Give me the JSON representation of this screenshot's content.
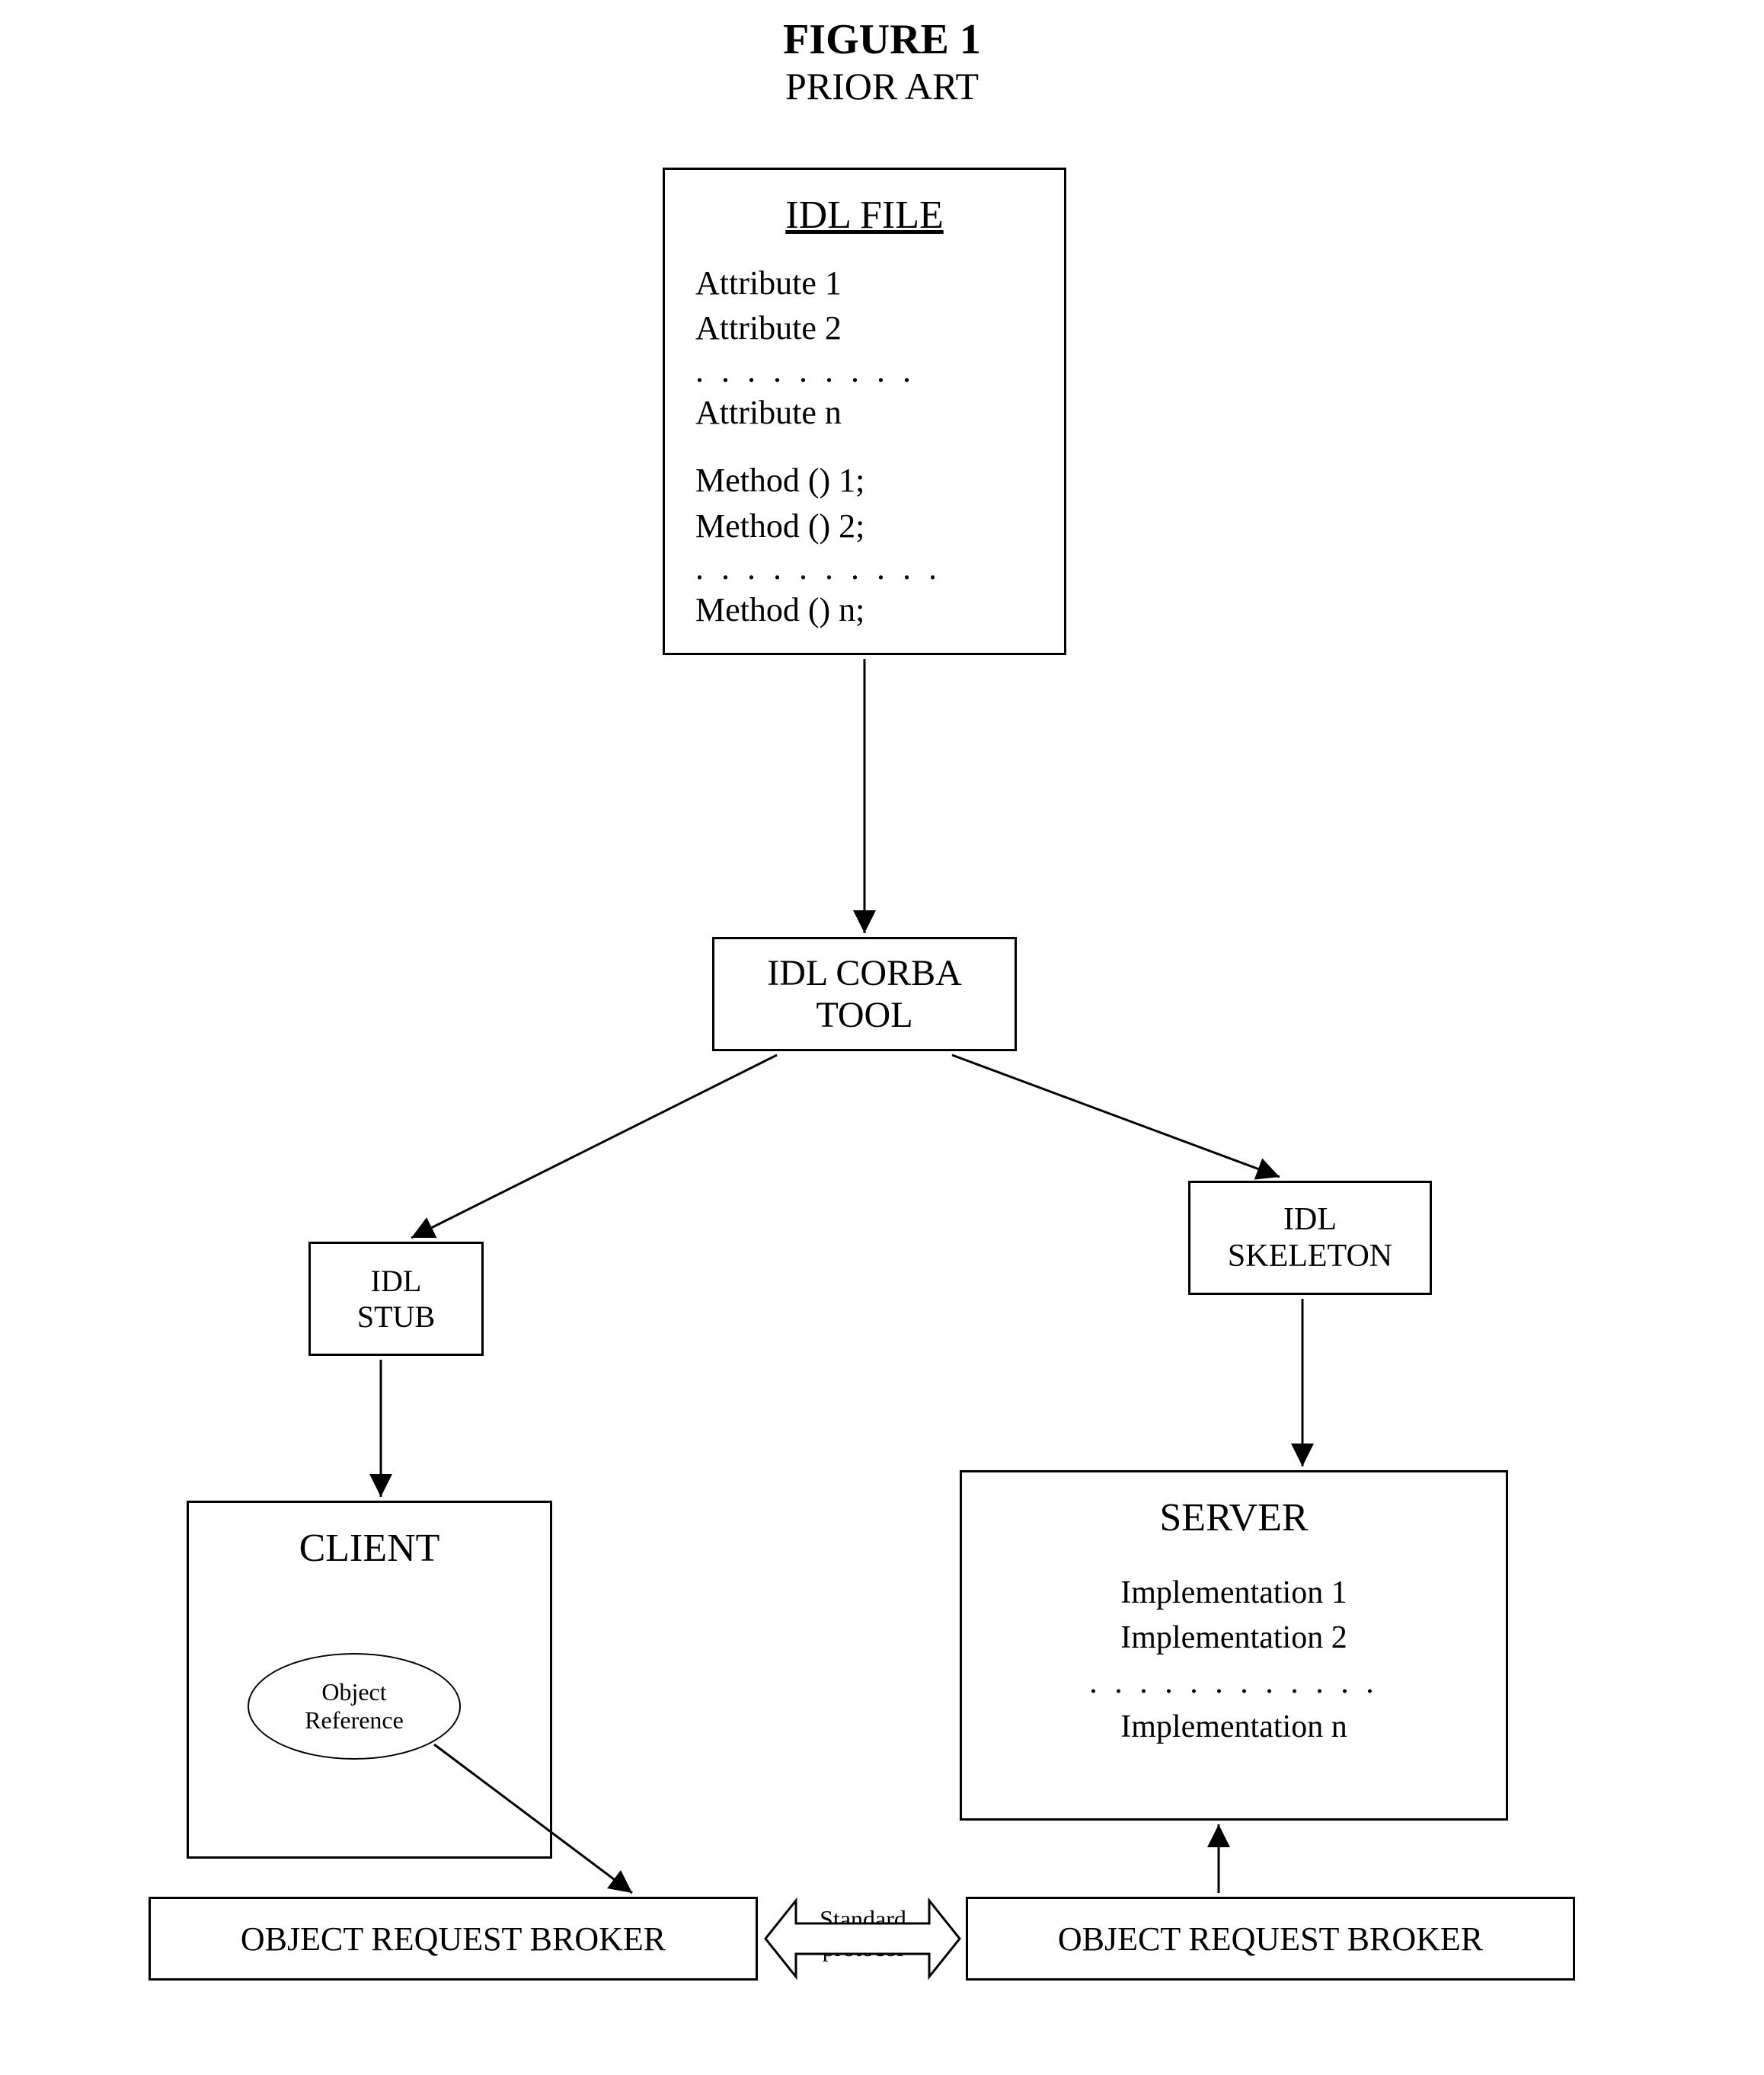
{
  "figure": {
    "number": "FIGURE 1",
    "subtitle": "PRIOR ART"
  },
  "idl_file": {
    "title": "IDL FILE",
    "attr1": "Attribute 1",
    "attr2": "Attribute 2",
    "attr_dots": ". . . . . . . . .",
    "attrN": "Attribute n",
    "meth1": "Method () 1;",
    "meth2": "Method () 2;",
    "meth_dots": ". . . . . . . . . .",
    "methN": "Method () n;"
  },
  "corba": {
    "line1": "IDL CORBA",
    "line2": "TOOL"
  },
  "stub": {
    "line1": "IDL",
    "line2": "STUB"
  },
  "skeleton": {
    "line1": "IDL",
    "line2": "SKELETON"
  },
  "client": {
    "title": "CLIENT",
    "objref1": "Object",
    "objref2": "Reference"
  },
  "server": {
    "title": "SERVER",
    "impl1": "Implementation 1",
    "impl2": "Implementation 2",
    "dots": ". . . . . . . . . . . .",
    "implN": "Implementation n"
  },
  "orb": {
    "left": "OBJECT REQUEST BROKER",
    "right": "OBJECT REQUEST BROKER"
  },
  "protocol": {
    "line1": "Standard",
    "line2": "protocol"
  }
}
